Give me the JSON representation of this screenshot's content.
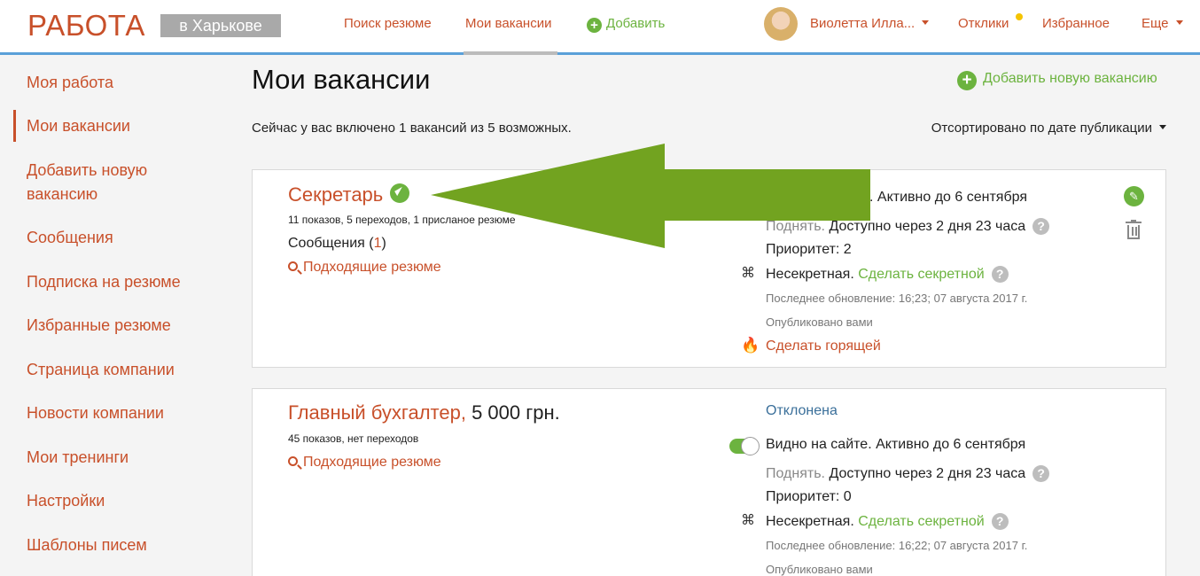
{
  "header": {
    "logo": "РАБОТА",
    "city": "в Харькове",
    "nav": {
      "search_resume": "Поиск резюме",
      "my_vacancies": "Мои вакансии",
      "add": "Добавить"
    },
    "user": {
      "name": "Виолетта Илла..."
    },
    "responses": "Отклики",
    "favorites": "Избранное",
    "more": "Еще"
  },
  "sidebar": {
    "items": [
      {
        "label": "Моя работа"
      },
      {
        "label": "Мои вакансии"
      },
      {
        "label": "Добавить новую вакансию"
      },
      {
        "label": "Сообщения"
      },
      {
        "label": "Подписка на резюме"
      },
      {
        "label": "Избранные резюме"
      },
      {
        "label": "Страница компании"
      },
      {
        "label": "Новости компании"
      },
      {
        "label": "Мои тренинги"
      },
      {
        "label": "Настройки"
      },
      {
        "label": "Шаблоны писем"
      }
    ]
  },
  "main": {
    "title": "Мои вакансии",
    "add_new": "Добавить новую вакансию",
    "status_text": "Сейчас у вас включено 1 вакансий из 5 возможных.",
    "sort_label": "Отсортировано по дате публикации"
  },
  "vacancies": [
    {
      "title": "Секретарь",
      "stats": "11 показов, 5 переходов, 1 присланое резюме",
      "messages_label": "Сообщения",
      "messages_count": "1",
      "matching_resumes": "Подходящие резюме",
      "visibility_partial": ". Активно до 6 сентября",
      "raise_label": "Поднять.",
      "raise_available": "Доступно через 2 дня 23 часа",
      "priority": "Приоритет: 2",
      "secret_status": "Несекретная.",
      "make_secret": "Сделать секретной",
      "last_update": "Последнее обновление: 16;23; 07 августа 2017 г.",
      "published_by": "Опубликовано вами",
      "make_hot": "Сделать горящей"
    },
    {
      "title": "Главный бухгалтер,",
      "salary": "5 000 грн.",
      "stats": "45 показов, нет переходов",
      "matching_resumes": "Подходящие резюме",
      "status": "Отклонена",
      "visibility": "Видно на сайте. Активно до 6 сентября",
      "raise_label": "Поднять.",
      "raise_available": "Доступно через 2 дня 23 часа",
      "priority": "Приоритет: 0",
      "secret_status": "Несекретная.",
      "make_secret": "Сделать секретной",
      "last_update": "Последнее обновление: 16;22; 07 августа 2017 г.",
      "published_by": "Опубликовано вами"
    }
  ],
  "colors": {
    "brand": "#c8502a",
    "green": "#6cb33f",
    "header_border": "#5aa0d8",
    "arrow": "#72a320"
  }
}
